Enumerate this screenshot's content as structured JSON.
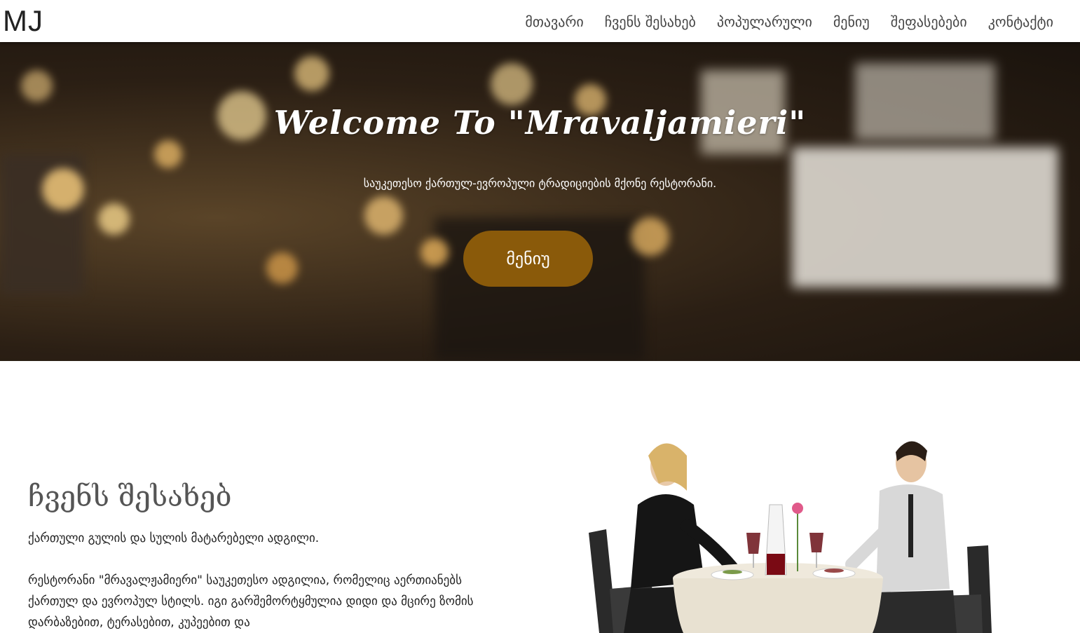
{
  "logo": "MJ",
  "nav": {
    "items": [
      "მთავარი",
      "ჩვენს შესახებ",
      "პოპულარული",
      "მენიუ",
      "შეფასებები",
      "კონტაქტი"
    ]
  },
  "hero": {
    "title": "Welcome To \"Mravaljamieri\"",
    "subtitle": "საუკეთესო ქართულ-ევროპული ტრადიციების მქონე რესტორანი.",
    "button": "მენიუ"
  },
  "about": {
    "title": "ჩვენს შესახებ",
    "lead": "ქართული გულის და სულის მატარებელი ადგილი.",
    "body": "რესტორანი \"მრავალჟამიერი\" საუკეთესო ადგილია, რომელიც აერთიანებს ქართულ და ევროპულ სტილს. იგი გარშემორტყმულია დიდი და მცირე ზომის დარბაზებით, ტერასებით, კუპეებით და"
  },
  "colors": {
    "accent": "#8a5a0a",
    "header_bg": "#ffffff",
    "title_gray": "#555555"
  }
}
